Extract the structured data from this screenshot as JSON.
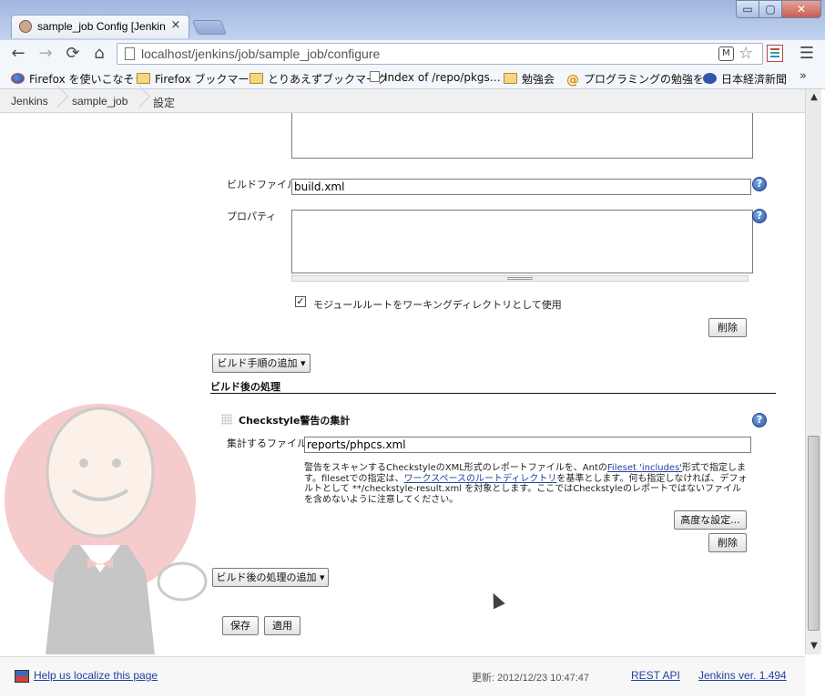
{
  "browser": {
    "tab_title": "sample_job Config [Jenkins]",
    "tab_close": "×",
    "window_controls": {
      "minimize": "▭",
      "maximize": "▢",
      "close": "✕"
    },
    "nav": {
      "back": "←",
      "forward": "→",
      "reload": "⟳",
      "home": "⌂"
    },
    "url": "localhost/jenkins/job/sample_job/configure",
    "menu": "☰"
  },
  "bookmarks": [
    {
      "label": "Firefox を使いこなそう",
      "icon": "firefox-icon"
    },
    {
      "label": "Firefox ブックマーク",
      "icon": "folder-icon"
    },
    {
      "label": "とりあえずブックマーク",
      "icon": "folder-icon"
    },
    {
      "label": "Index of /repo/pkgs…",
      "icon": "page-icon"
    },
    {
      "label": "勉強会",
      "icon": "folder-icon"
    },
    {
      "label": "プログラミングの勉強を…",
      "icon": "at-icon"
    },
    {
      "label": "日本経済新聞",
      "icon": "paw-icon"
    }
  ],
  "bookmarks_more": "»",
  "breadcrumb": [
    "Jenkins",
    "sample_job",
    "設定"
  ],
  "form": {
    "build_file_label": "ビルドファイル",
    "build_file_value": "build.xml",
    "properties_label": "プロパティ",
    "use_module_root_label": "モジュールルートをワーキングディレクトリとして使用",
    "use_module_root_checked": "✓",
    "delete_label": "削除",
    "add_build_step_label": "ビルド手順の追加 ▾",
    "post_build_section": "ビルド後の処理",
    "checkstyle_title": "Checkstyle警告の集計",
    "aggregate_file_label": "集計するファイル",
    "aggregate_file_value": "reports/phpcs.xml",
    "desc_part1": "警告をスキャンするCheckstyleのXML形式のレポートファイルを、Antの",
    "desc_link1": "Fileset 'includes'",
    "desc_part2": "形式で指定します。filesetでの指定は、",
    "desc_link2": "ワークスペースのルートディレクトリ",
    "desc_part3": "を基準とします。何も指定しなければ、デフォルトとして **/checkstyle-result.xml を対象とします。ここではCheckstyleのレポートではないファイルを含めないように注意してください。",
    "advanced_label": "高度な設定...",
    "add_post_build_label": "ビルド後の処理の追加 ▾",
    "save_label": "保存",
    "apply_label": "適用",
    "help_glyph": "?"
  },
  "footer": {
    "localize_link": "Help us localize this page",
    "updated": "更新: 2012/12/23 10:47:47",
    "rest_api": "REST API",
    "version": "Jenkins ver. 1.494"
  },
  "scrollbar": {
    "up": "▲",
    "down": "▼"
  }
}
